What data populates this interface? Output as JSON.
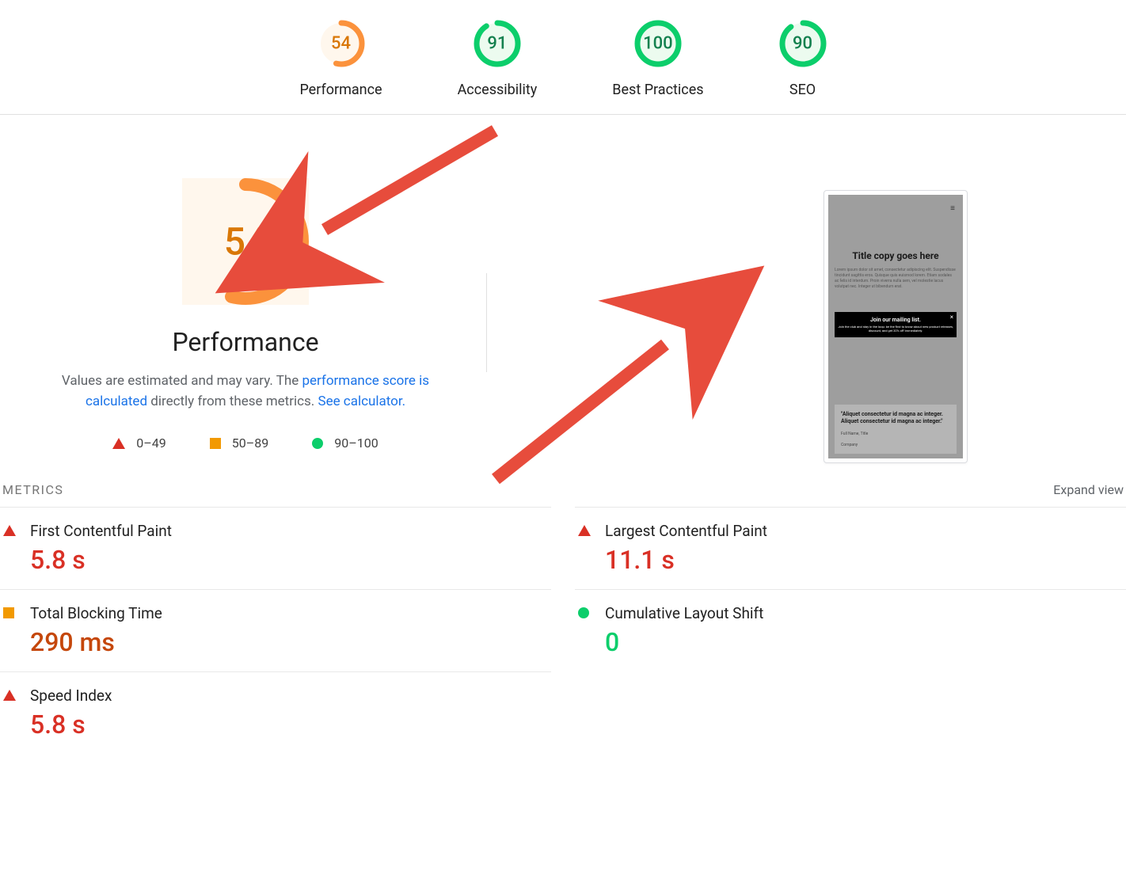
{
  "top_scores": [
    {
      "label": "Performance",
      "score": 54,
      "color": "#fb923c",
      "bg": "#fff7ed",
      "textColor": "#d97706",
      "pct": 0.54
    },
    {
      "label": "Accessibility",
      "score": 91,
      "color": "#0cce6b",
      "bg": "#ecfbef",
      "textColor": "#13804e",
      "pct": 0.91
    },
    {
      "label": "Best Practices",
      "score": 100,
      "color": "#0cce6b",
      "bg": "#ecfbef",
      "textColor": "#13804e",
      "pct": 1.0
    },
    {
      "label": "SEO",
      "score": 90,
      "color": "#0cce6b",
      "bg": "#ecfbef",
      "textColor": "#13804e",
      "pct": 0.9
    }
  ],
  "main": {
    "score": 54,
    "title": "Performance",
    "desc_prefix": "Values are estimated and may vary. The ",
    "desc_link1": "performance score is calculated",
    "desc_mid": " directly from these metrics. ",
    "desc_link2": "See calculator.",
    "legend": [
      {
        "range": "0–49"
      },
      {
        "range": "50–89"
      },
      {
        "range": "90–100"
      }
    ]
  },
  "preview": {
    "title": "Title copy goes here",
    "lorem": "Lorem ipsum dolor sit amet, consectetur adipiscing elit. Suspendisse tincidunt sagittis eros. Quisque quis euismod lorem. Etiam sodales ac felis id interdum. Proin viverra nulla sem, vel molestie lacus volutpat nec. Integer ut bibendum erat.",
    "banner_title": "Join our mailing list.",
    "banner_sub": "Join the club and stay in the loop: be the first to know about new product releases, discount, and get 20% off immediately.",
    "quote": "\"Aliquet consectetur id magna ac integer. Aliquet consectetur id magna ac integer.\"",
    "attr1": "Full Name, Title",
    "attr2": "Company"
  },
  "metrics": {
    "header": "METRICS",
    "expand": "Expand view",
    "left": [
      {
        "name": "First Contentful Paint",
        "value": "5.8 s",
        "level": "red"
      },
      {
        "name": "Total Blocking Time",
        "value": "290 ms",
        "level": "orange"
      },
      {
        "name": "Speed Index",
        "value": "5.8 s",
        "level": "red"
      }
    ],
    "right": [
      {
        "name": "Largest Contentful Paint",
        "value": "11.1 s",
        "level": "red"
      },
      {
        "name": "Cumulative Layout Shift",
        "value": "0",
        "level": "green"
      }
    ]
  }
}
